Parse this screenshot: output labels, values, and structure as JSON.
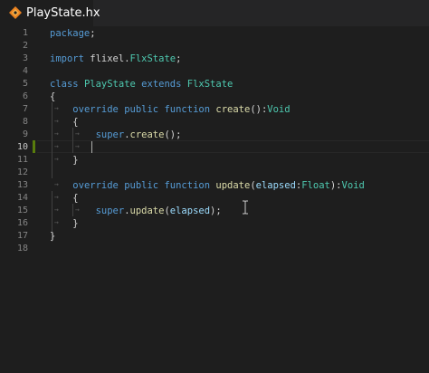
{
  "tab": {
    "title": "PlayState.hx",
    "icon": "haxe-file-icon",
    "icon_color": "#ea8220"
  },
  "editor": {
    "lines": [
      {
        "n": "1",
        "tokens": [
          {
            "t": "package",
            "c": "kw"
          },
          {
            "t": ";",
            "c": "plain"
          }
        ]
      },
      {
        "n": "2",
        "tokens": []
      },
      {
        "n": "3",
        "tokens": [
          {
            "t": "import",
            "c": "kw"
          },
          {
            "t": " flixel.",
            "c": "plain"
          },
          {
            "t": "FlxState",
            "c": "type"
          },
          {
            "t": ";",
            "c": "plain"
          }
        ]
      },
      {
        "n": "4",
        "tokens": []
      },
      {
        "n": "5",
        "tokens": [
          {
            "t": "class",
            "c": "kw"
          },
          {
            "t": " ",
            "c": "plain"
          },
          {
            "t": "PlayState",
            "c": "type"
          },
          {
            "t": " ",
            "c": "plain"
          },
          {
            "t": "extends",
            "c": "kw"
          },
          {
            "t": " ",
            "c": "plain"
          },
          {
            "t": "FlxState",
            "c": "type"
          }
        ]
      },
      {
        "n": "6",
        "tokens": [
          {
            "t": "{",
            "c": "plain"
          }
        ]
      },
      {
        "n": "7",
        "tokens": [
          {
            "t": "    ",
            "c": "plain"
          },
          {
            "t": "override",
            "c": "kw"
          },
          {
            "t": " ",
            "c": "plain"
          },
          {
            "t": "public",
            "c": "kw"
          },
          {
            "t": " ",
            "c": "plain"
          },
          {
            "t": "function",
            "c": "kw"
          },
          {
            "t": " ",
            "c": "plain"
          },
          {
            "t": "create",
            "c": "fn"
          },
          {
            "t": "():",
            "c": "plain"
          },
          {
            "t": "Void",
            "c": "type"
          }
        ]
      },
      {
        "n": "8",
        "tokens": [
          {
            "t": "    {",
            "c": "plain"
          }
        ]
      },
      {
        "n": "9",
        "tokens": [
          {
            "t": "        ",
            "c": "plain"
          },
          {
            "t": "super",
            "c": "kw"
          },
          {
            "t": ".",
            "c": "plain"
          },
          {
            "t": "create",
            "c": "fn"
          },
          {
            "t": "();",
            "c": "plain"
          }
        ]
      },
      {
        "n": "10",
        "tokens": [],
        "current": true
      },
      {
        "n": "11",
        "tokens": [
          {
            "t": "    }",
            "c": "plain"
          }
        ]
      },
      {
        "n": "12",
        "tokens": []
      },
      {
        "n": "13",
        "tokens": [
          {
            "t": "    ",
            "c": "plain"
          },
          {
            "t": "override",
            "c": "kw"
          },
          {
            "t": " ",
            "c": "plain"
          },
          {
            "t": "public",
            "c": "kw"
          },
          {
            "t": " ",
            "c": "plain"
          },
          {
            "t": "function",
            "c": "kw"
          },
          {
            "t": " ",
            "c": "plain"
          },
          {
            "t": "update",
            "c": "fn"
          },
          {
            "t": "(",
            "c": "plain"
          },
          {
            "t": "elapsed",
            "c": "param"
          },
          {
            "t": ":",
            "c": "plain"
          },
          {
            "t": "Float",
            "c": "type"
          },
          {
            "t": "):",
            "c": "plain"
          },
          {
            "t": "Void",
            "c": "type"
          }
        ]
      },
      {
        "n": "14",
        "tokens": [
          {
            "t": "    {",
            "c": "plain"
          }
        ]
      },
      {
        "n": "15",
        "tokens": [
          {
            "t": "        ",
            "c": "plain"
          },
          {
            "t": "super",
            "c": "kw"
          },
          {
            "t": ".",
            "c": "plain"
          },
          {
            "t": "update",
            "c": "fn"
          },
          {
            "t": "(",
            "c": "plain"
          },
          {
            "t": "elapsed",
            "c": "param"
          },
          {
            "t": ");",
            "c": "plain"
          }
        ]
      },
      {
        "n": "16",
        "tokens": [
          {
            "t": "    }",
            "c": "plain"
          }
        ]
      },
      {
        "n": "17",
        "tokens": [
          {
            "t": "}",
            "c": "plain"
          }
        ]
      },
      {
        "n": "18",
        "tokens": []
      }
    ]
  },
  "colors": {
    "background": "#1e1e1e",
    "keyword": "#569cd6",
    "type": "#4ec9b0",
    "function": "#dcdcaa",
    "parameter": "#9cdcfe",
    "text": "#d4d4d4",
    "modified_gutter": "#587c0c"
  }
}
